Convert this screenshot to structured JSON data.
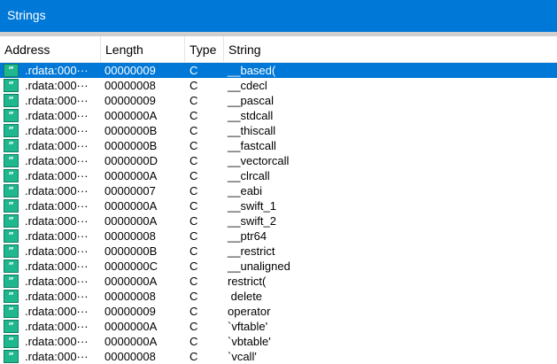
{
  "window": {
    "title": "Strings"
  },
  "columns": {
    "address": "Address",
    "length": "Length",
    "type": "Type",
    "string": "String"
  },
  "rows": [
    {
      "address": ".rdata:000···",
      "length": "00000009",
      "type": "C",
      "string": "__based(",
      "selected": true
    },
    {
      "address": ".rdata:000···",
      "length": "00000008",
      "type": "C",
      "string": "__cdecl"
    },
    {
      "address": ".rdata:000···",
      "length": "00000009",
      "type": "C",
      "string": "__pascal"
    },
    {
      "address": ".rdata:000···",
      "length": "0000000A",
      "type": "C",
      "string": "__stdcall"
    },
    {
      "address": ".rdata:000···",
      "length": "0000000B",
      "type": "C",
      "string": "__thiscall"
    },
    {
      "address": ".rdata:000···",
      "length": "0000000B",
      "type": "C",
      "string": "__fastcall"
    },
    {
      "address": ".rdata:000···",
      "length": "0000000D",
      "type": "C",
      "string": "__vectorcall"
    },
    {
      "address": ".rdata:000···",
      "length": "0000000A",
      "type": "C",
      "string": "__clrcall"
    },
    {
      "address": ".rdata:000···",
      "length": "00000007",
      "type": "C",
      "string": "__eabi"
    },
    {
      "address": ".rdata:000···",
      "length": "0000000A",
      "type": "C",
      "string": "__swift_1"
    },
    {
      "address": ".rdata:000···",
      "length": "0000000A",
      "type": "C",
      "string": "__swift_2"
    },
    {
      "address": ".rdata:000···",
      "length": "00000008",
      "type": "C",
      "string": "__ptr64"
    },
    {
      "address": ".rdata:000···",
      "length": "0000000B",
      "type": "C",
      "string": "__restrict"
    },
    {
      "address": ".rdata:000···",
      "length": "0000000C",
      "type": "C",
      "string": "__unaligned"
    },
    {
      "address": ".rdata:000···",
      "length": "0000000A",
      "type": "C",
      "string": "restrict("
    },
    {
      "address": ".rdata:000···",
      "length": "00000008",
      "type": "C",
      "string": " delete"
    },
    {
      "address": ".rdata:000···",
      "length": "00000009",
      "type": "C",
      "string": "operator"
    },
    {
      "address": ".rdata:000···",
      "length": "0000000A",
      "type": "C",
      "string": "`vftable'"
    },
    {
      "address": ".rdata:000···",
      "length": "0000000A",
      "type": "C",
      "string": "`vbtable'"
    },
    {
      "address": ".rdata:000···",
      "length": "00000008",
      "type": "C",
      "string": "`vcall'"
    }
  ],
  "row_icon": {
    "name": "string-icon",
    "glyph": "”"
  },
  "colors": {
    "accent": "#0078d7",
    "icon": "#1fb78e"
  }
}
